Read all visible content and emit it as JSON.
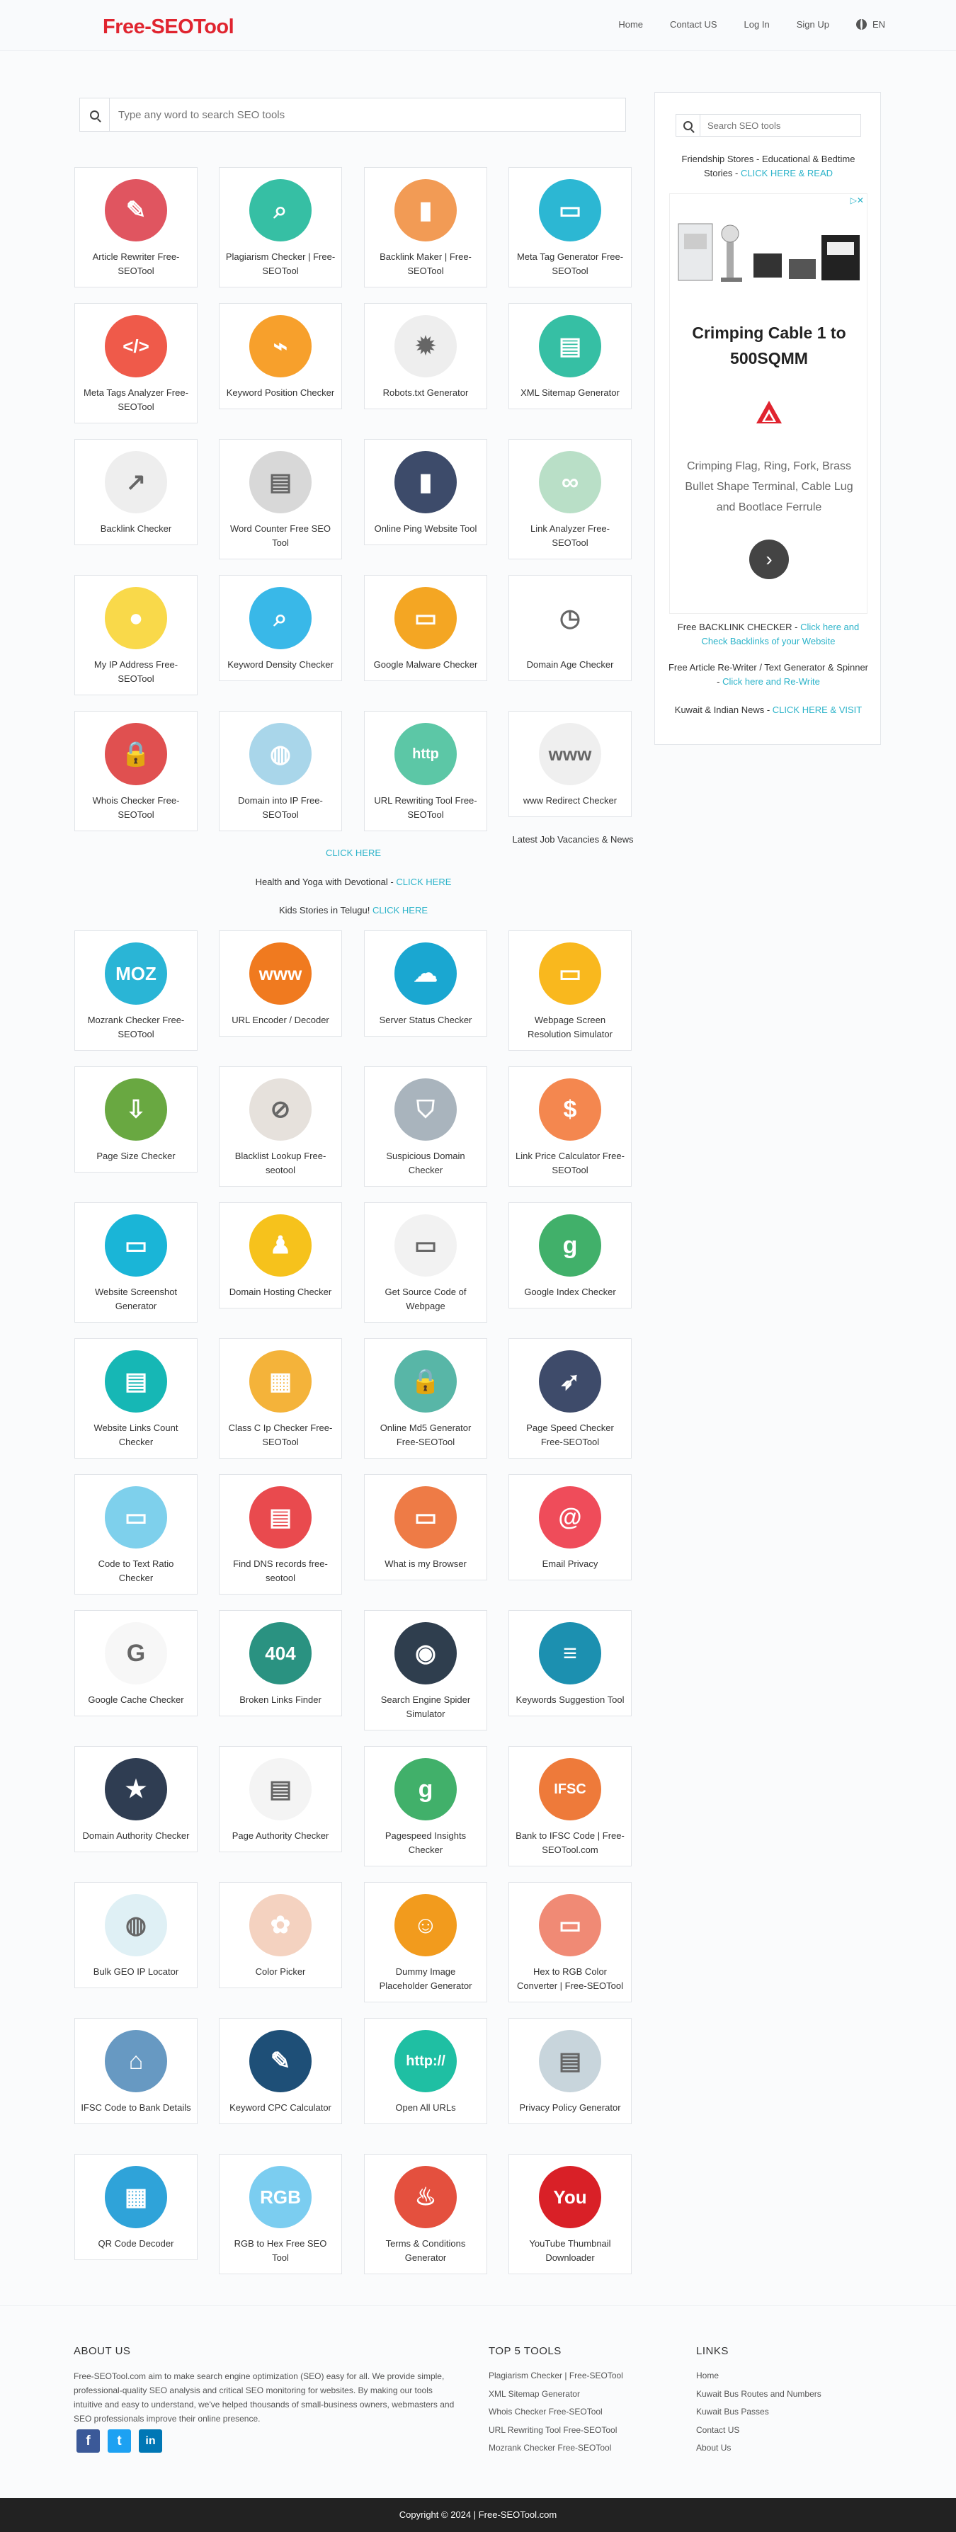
{
  "header": {
    "logo": "Free-SEOTool",
    "nav": [
      "Home",
      "Contact US",
      "Log In",
      "Sign Up"
    ],
    "lang": "EN"
  },
  "search": {
    "placeholder": "Type any word to search SEO tools"
  },
  "tools_a": [
    {
      "label": "Article Rewriter Free-SEOTool",
      "color": "#e05560",
      "icon": "✎"
    },
    {
      "label": "Plagiarism Checker | Free-SEOTool",
      "color": "#36bfa4",
      "icon": "⌕"
    },
    {
      "label": "Backlink Maker | Free-SEOTool",
      "color": "#f29b55",
      "icon": "▮"
    },
    {
      "label": "Meta Tag Generator Free-SEOTool",
      "color": "#2cb7d3",
      "icon": "▭"
    },
    {
      "label": "Meta Tags Analyzer Free-SEOTool",
      "color": "#ef5a4a",
      "icon": "</>"
    },
    {
      "label": "Keyword Position Checker",
      "color": "#f7a02c",
      "icon": "⌁"
    },
    {
      "label": "Robots.txt Generator",
      "color": "#eeeeee",
      "icon": "✹"
    },
    {
      "label": "XML Sitemap Generator",
      "color": "#36bfa4",
      "icon": "▤"
    },
    {
      "label": "Backlink Checker",
      "color": "#eeeeee",
      "icon": "↗"
    },
    {
      "label": "Word Counter Free SEO Tool",
      "color": "#d8d8d8",
      "icon": "▤"
    },
    {
      "label": "Online Ping Website Tool",
      "color": "#3d4b6a",
      "icon": "▮"
    },
    {
      "label": "Link Analyzer Free-SEOTool",
      "color": "#b9dfc7",
      "icon": "∞"
    },
    {
      "label": "My IP Address Free-SEOTool",
      "color": "#f9d94a",
      "icon": "●"
    },
    {
      "label": "Keyword Density Checker",
      "color": "#39b8e8",
      "icon": "⌕"
    },
    {
      "label": "Google Malware Checker",
      "color": "#f4a623",
      "icon": "▭"
    },
    {
      "label": "Domain Age Checker",
      "color": "#ffffff",
      "icon": "◷"
    },
    {
      "label": "Whois Checker Free-SEOTool",
      "color": "#e05050",
      "icon": "🔒"
    },
    {
      "label": "Domain into IP Free-SEOTool",
      "color": "#a9d6ea",
      "icon": "◍"
    },
    {
      "label": "URL Rewriting Tool Free-SEOTool",
      "color": "#5cc7a6",
      "icon": "http"
    },
    {
      "label": "www Redirect Checker",
      "color": "#efefef",
      "icon": "www"
    }
  ],
  "promo": {
    "side_text": "Latest Job Vacancies & News",
    "click_here": "CLICK HERE",
    "health": "Health and Yoga with Devotional - ",
    "health_link": "CLICK HERE",
    "kids": "Kids Stories in Telugu! ",
    "kids_link": "CLICK HERE"
  },
  "tools_b": [
    {
      "label": "Mozrank Checker Free-SEOTool",
      "color": "#2ab5d6",
      "icon": "MOZ"
    },
    {
      "label": "URL Encoder / Decoder",
      "color": "#f07a1f",
      "icon": "www"
    },
    {
      "label": "Server Status Checker",
      "color": "#1aa7d1",
      "icon": "☁"
    },
    {
      "label": "Webpage Screen Resolution Simulator",
      "color": "#f9b81e",
      "icon": "▭"
    },
    {
      "label": "Page Size Checker",
      "color": "#69a841",
      "icon": "⇩"
    },
    {
      "label": "Blacklist Lookup Free-seotool",
      "color": "#e6e1dc",
      "icon": "⊘"
    },
    {
      "label": "Suspicious Domain Checker",
      "color": "#a9b4bd",
      "icon": "⛉"
    },
    {
      "label": "Link Price Calculator Free-SEOTool",
      "color": "#f4874f",
      "icon": "$"
    },
    {
      "label": "Website Screenshot Generator",
      "color": "#1ab5d7",
      "icon": "▭"
    },
    {
      "label": "Domain Hosting Checker",
      "color": "#f6c21c",
      "icon": "♟"
    },
    {
      "label": "Get Source Code of Webpage",
      "color": "#f2f2f2",
      "icon": "▭"
    },
    {
      "label": "Google Index Checker",
      "color": "#41b06a",
      "icon": "g"
    },
    {
      "label": "Website Links Count Checker",
      "color": "#16b7b5",
      "icon": "▤"
    },
    {
      "label": "Class C Ip Checker Free-SEOTool",
      "color": "#f4b33a",
      "icon": "▦"
    },
    {
      "label": "Online Md5 Generator Free-SEOTool",
      "color": "#58b6a7",
      "icon": "🔒"
    },
    {
      "label": "Page Speed Checker Free-SEOTool",
      "color": "#3e4b6a",
      "icon": "➶"
    },
    {
      "label": "Code to Text Ratio Checker",
      "color": "#7ed0ec",
      "icon": "▭"
    },
    {
      "label": "Find DNS records free-seotool",
      "color": "#e94a4e",
      "icon": "▤"
    },
    {
      "label": "What is my Browser",
      "color": "#ee7b46",
      "icon": "▭"
    },
    {
      "label": "Email Privacy",
      "color": "#ef4c5a",
      "icon": "@"
    },
    {
      "label": "Google Cache Checker",
      "color": "#f7f7f7",
      "icon": "G"
    },
    {
      "label": "Broken Links Finder",
      "color": "#2a9281",
      "icon": "404"
    },
    {
      "label": "Search Engine Spider Simulator",
      "color": "#2f3e4e",
      "icon": "◉"
    },
    {
      "label": "Keywords Suggestion Tool",
      "color": "#1c90b0",
      "icon": "≡"
    },
    {
      "label": "Domain Authority Checker",
      "color": "#2f3d52",
      "icon": "★"
    },
    {
      "label": "Page Authority Checker",
      "color": "#f4f4f4",
      "icon": "▤"
    },
    {
      "label": "Pagespeed Insights Checker",
      "color": "#41b06a",
      "icon": "g"
    },
    {
      "label": "Bank to IFSC Code | Free-SEOTool.com",
      "color": "#ee7a3a",
      "icon": "IFSC"
    },
    {
      "label": "Bulk GEO IP Locator",
      "color": "#dff0f5",
      "icon": "◍"
    },
    {
      "label": "Color Picker",
      "color": "#f4d2c0",
      "icon": "✿"
    },
    {
      "label": "Dummy Image Placeholder Generator",
      "color": "#f29b1d",
      "icon": "☺"
    },
    {
      "label": "Hex to RGB Color Converter | Free-SEOTool",
      "color": "#f08a75",
      "icon": "▭"
    },
    {
      "label": "IFSC Code to Bank Details",
      "color": "#6799c2",
      "icon": "⌂"
    },
    {
      "label": "Keyword CPC Calculator",
      "color": "#1e4f77",
      "icon": "✎"
    },
    {
      "label": "Open All URLs",
      "color": "#1fbfa3",
      "icon": "http://"
    },
    {
      "label": "Privacy Policy Generator",
      "color": "#c8d5dc",
      "icon": "▤"
    },
    {
      "label": "QR Code Decoder",
      "color": "#2fa3d9",
      "icon": "▦"
    },
    {
      "label": "RGB to Hex Free SEO Tool",
      "color": "#7bcdf0",
      "icon": "RGB"
    },
    {
      "label": "Terms & Conditions Generator",
      "color": "#e4503e",
      "icon": "♨"
    },
    {
      "label": "YouTube Thumbnail Downloader",
      "color": "#d92027",
      "icon": "You"
    }
  ],
  "sidebar": {
    "search_placeholder": "Search SEO tools",
    "friend": "Friendship Stores - Educational & Bedtime Stories - ",
    "friend_link": "CLICK HERE & READ",
    "ad_close": "▷✕",
    "ad_title": "Crimping Cable 1 to 500SQMM",
    "ad_desc": "Crimping Flag, Ring, Fork, Brass Bullet Shape Terminal, Cable Lug and Bootlace Ferrule",
    "ad_arrow": "›",
    "backlink": "Free BACKLINK CHECKER - ",
    "backlink_link": "Click here and Check Backlinks of your Website",
    "rewriter": "Free Article Re-Writer / Text Generator & Spinner - ",
    "rewriter_link": "Click here and Re-Write",
    "kuwait": "Kuwait & Indian News - ",
    "kuwait_link": "CLICK HERE & VISIT"
  },
  "footer": {
    "about_title": "ABOUT US",
    "about_text": "Free-SEOTool.com aim to make search engine optimization (SEO) easy for all. We provide simple, professional-quality SEO analysis and critical SEO monitoring for websites. By making our tools intuitive and easy to understand, we've helped thousands of small-business owners, webmasters and SEO professionals improve their online presence.",
    "top_title": "TOP 5 TOOLS",
    "top_tools": [
      "Plagiarism Checker | Free-SEOTool",
      "XML Sitemap Generator",
      "Whois Checker Free-SEOTool",
      "URL Rewriting Tool Free-SEOTool",
      "Mozrank Checker Free-SEOTool"
    ],
    "links_title": "LINKS",
    "links": [
      "Home",
      "Kuwait Bus Routes and Numbers",
      "Kuwait Bus Passes",
      "Contact US",
      "About Us"
    ],
    "social": [
      "f",
      "t",
      "in"
    ],
    "copyright": "Copyright © 2024 | Free-SEOTool.com"
  },
  "colors": {
    "brand": "#e0242f",
    "link": "#2bb3c9",
    "facebook": "#3b5998",
    "twitter": "#1da1f2",
    "linkedin": "#0077b5"
  }
}
